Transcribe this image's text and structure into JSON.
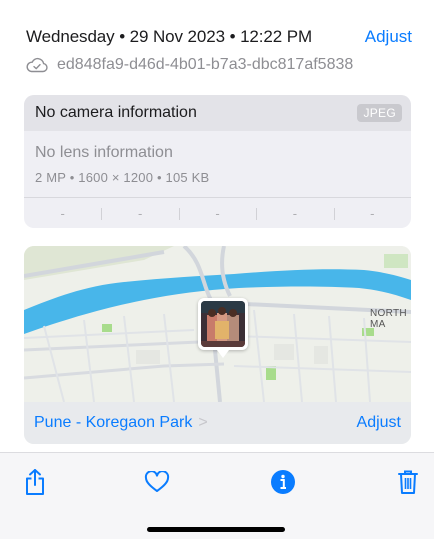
{
  "header": {
    "date_time": "Wednesday • 29 Nov 2023 • 12:22 PM",
    "adjust_label": "Adjust",
    "filename": "ed848fa9-d46d-4b01-b7a3-dbc817af5838",
    "cloud_icon": "cloud-check-icon"
  },
  "info": {
    "camera": "No camera information",
    "format_badge": "JPEG",
    "lens": "No lens information",
    "specs": "2 MP  •  1600 × 1200  •  105 KB",
    "exif_values": [
      "-",
      "-",
      "-",
      "-",
      "-"
    ]
  },
  "map": {
    "road_label": "NORTH MA",
    "location": "Pune - Koregaon Park",
    "chevron": ">",
    "adjust_label": "Adjust"
  },
  "toolbar": {
    "icons": [
      "share-icon",
      "heart-icon",
      "info-icon",
      "trash-icon"
    ]
  },
  "colors": {
    "accent": "#0a7cff",
    "secondary_text": "#8e8e93",
    "card_bg": "#efeff4",
    "river": "#48b6ea"
  }
}
